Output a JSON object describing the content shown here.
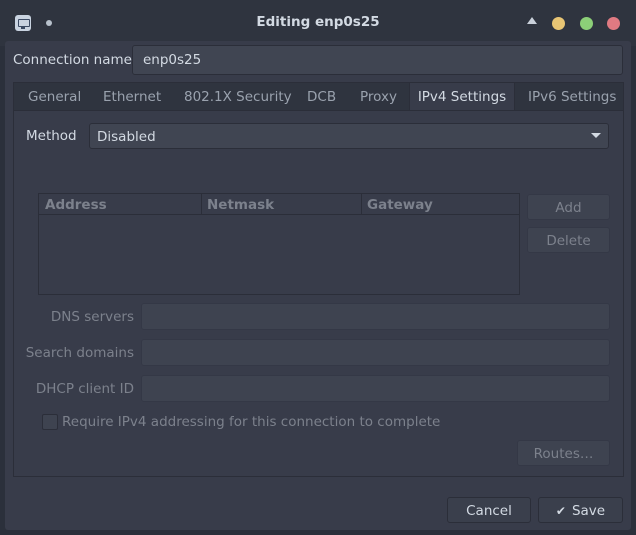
{
  "window": {
    "title": "Editing enp0s25"
  },
  "connection": {
    "label": "Connection name",
    "value": "enp0s25"
  },
  "tabs": [
    {
      "label": "General"
    },
    {
      "label": "Ethernet"
    },
    {
      "label": "802.1X Security"
    },
    {
      "label": "DCB"
    },
    {
      "label": "Proxy"
    },
    {
      "label": "IPv4 Settings"
    },
    {
      "label": "IPv6 Settings"
    }
  ],
  "active_tab": "IPv4 Settings",
  "method": {
    "label": "Method",
    "value": "Disabled"
  },
  "addresses": {
    "columns": [
      "Address",
      "Netmask",
      "Gateway"
    ],
    "rows": [],
    "add_label": "Add",
    "delete_label": "Delete"
  },
  "fields": {
    "dns_label": "DNS servers",
    "search_label": "Search domains",
    "dhcp_label": "DHCP client ID"
  },
  "require_label": "Require IPv4 addressing for this connection to complete",
  "routes_label": "Routes…",
  "footer": {
    "cancel_label": "Cancel",
    "save_label": "Save"
  },
  "colors": {
    "accent_close": "#e07a82",
    "accent_min": "#e8c574",
    "accent_max": "#8ccf78",
    "window_bg": "#383c4a"
  }
}
